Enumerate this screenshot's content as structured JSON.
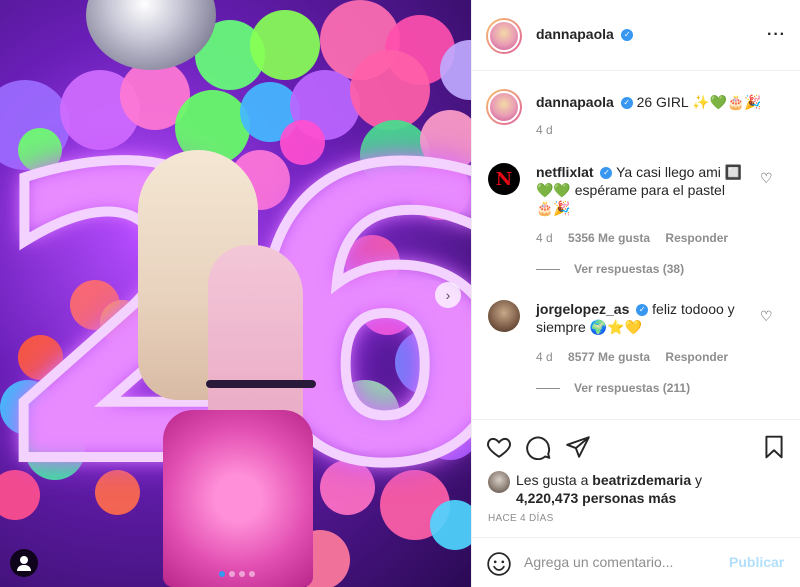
{
  "post": {
    "author": "dannapaola",
    "more_icon": "···"
  },
  "caption": {
    "username": "dannapaola",
    "text": "26 GIRL ✨💚🎂🎉",
    "time": "4 d"
  },
  "comments": [
    {
      "username": "netflixlat",
      "text_line1": "Ya casi llego ami 🔲",
      "text_line2": "💚💚 espérame para el pastel",
      "text_line3": "🎂🎉",
      "time": "4 d",
      "likes": "5356 Me gusta",
      "reply": "Responder",
      "view_replies": "Ver respuestas (38)"
    },
    {
      "username": "jorgelopez_as",
      "text_line1": "feliz todooo y",
      "text_line2": "siempre 🌍⭐💛",
      "time": "4 d",
      "likes": "8577 Me gusta",
      "reply": "Responder",
      "view_replies": "Ver respuestas (211)"
    }
  ],
  "likes": {
    "prefix": "Les gusta a",
    "user": "beatrizdemaria",
    "conj": "y",
    "count": "4,220,473 personas más"
  },
  "date_label": "HACE 4 DÍAS",
  "comment_box": {
    "placeholder": "Agrega un comentario...",
    "publish": "Publicar"
  },
  "photo": {
    "neon_text": "26"
  },
  "colors": {
    "accent": "#3897f0",
    "publish_disabled": "#b2dffc",
    "netflix_red": "#e50914"
  }
}
